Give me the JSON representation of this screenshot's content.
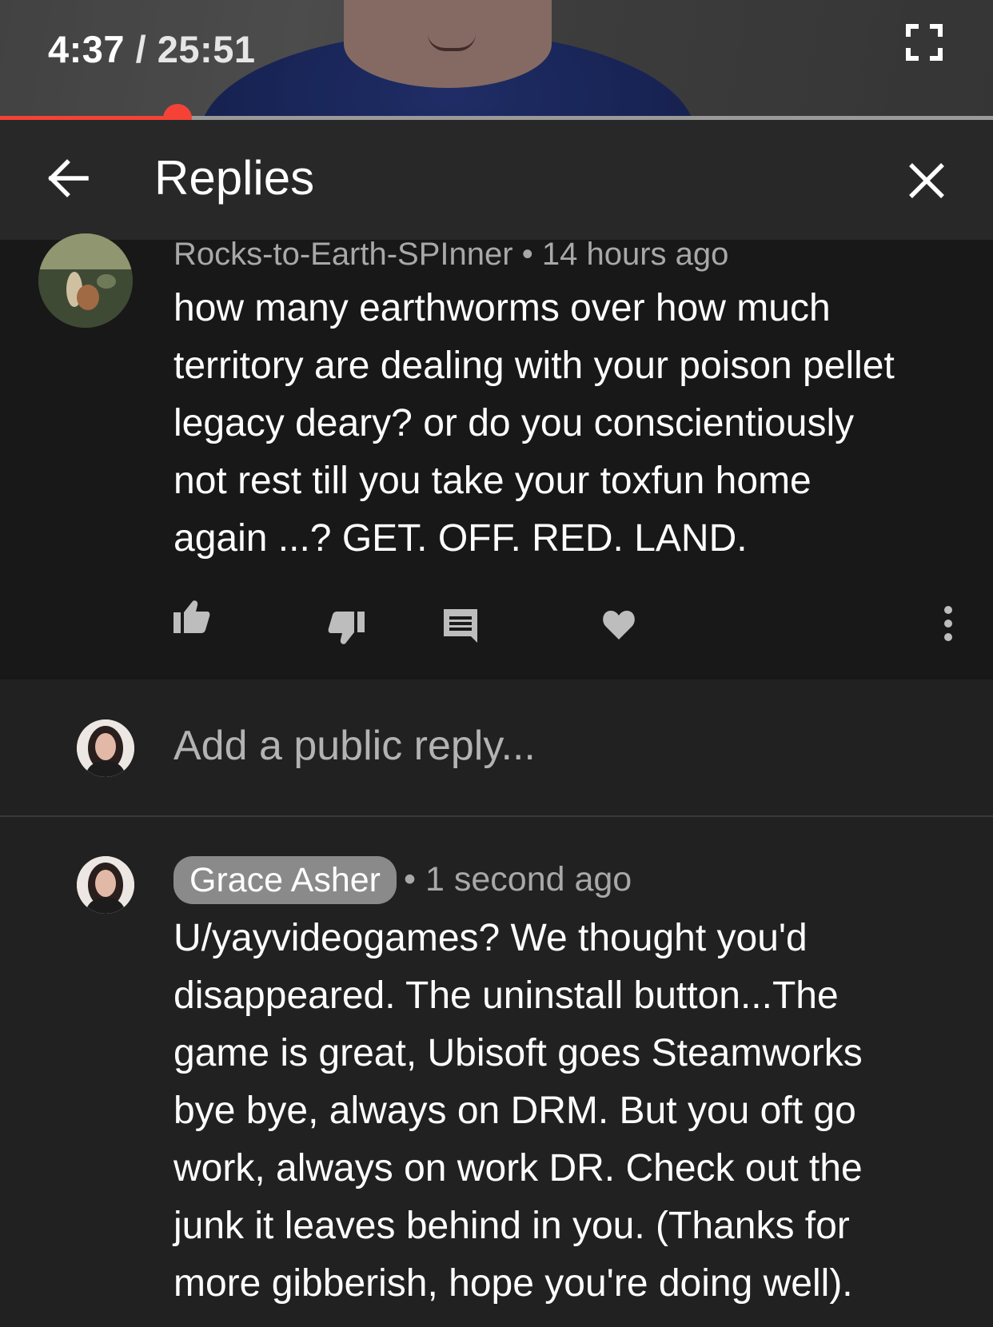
{
  "player": {
    "current_time": "4:37",
    "separator": "/",
    "duration": "25:51",
    "progress_fraction": 0.179,
    "fullscreen_icon": "fullscreen-icon"
  },
  "header": {
    "back_icon": "arrow-left-icon",
    "title": "Replies",
    "close_icon": "close-icon"
  },
  "parent_comment": {
    "author": "Rocks-to-Earth-SPInner",
    "bullet": "•",
    "time_ago": "14 hours ago",
    "text_lines": [
      "how many earthworms over how much",
      "territory are dealing with your poison pellet",
      "legacy deary? or do you conscientiously",
      "not rest till you take your toxfun home",
      "again ...? GET. OFF. RED. LAND."
    ],
    "actions": [
      "thumbs-up-icon",
      "thumbs-down-icon",
      "reply-icon",
      "heart-icon",
      "more-vert-icon"
    ]
  },
  "reply_input": {
    "placeholder": "Add a public reply..."
  },
  "reply_comment": {
    "author": "Grace Asher",
    "bullet": "•",
    "time_ago": "1 second ago",
    "text_lines": [
      "U/yayvideogames? We thought you'd",
      "disappeared.  The uninstall button...The",
      "game is great, Ubisoft goes Steamworks",
      "bye bye, always on DRM. But you oft go",
      "work, always on work DR. Check out the",
      "junk it leaves behind in you. (Thanks for",
      "more gibberish, hope you're doing well)."
    ]
  },
  "colors": {
    "progress": "#f44336",
    "background": "#212121",
    "highlight": "#181818",
    "header": "#282828"
  }
}
